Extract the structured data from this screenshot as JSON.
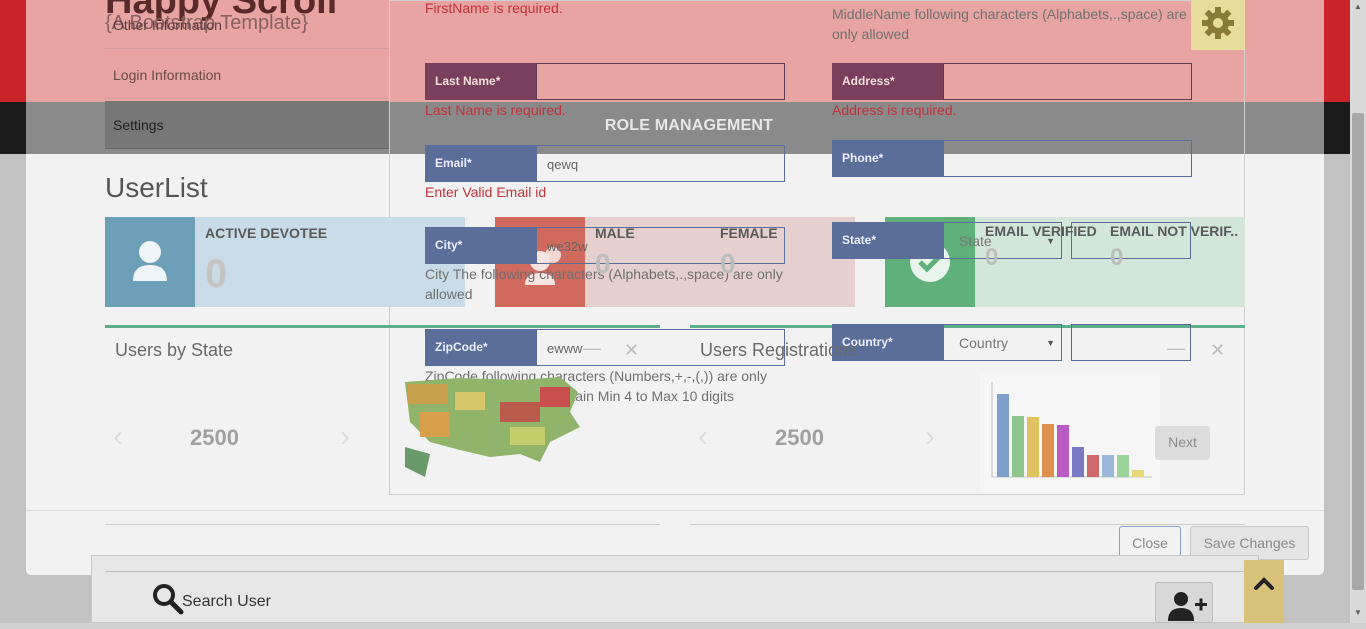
{
  "site": {
    "title": "Happy Scroll",
    "subtitle": "{A Bootstrap Template}"
  },
  "menu": {
    "items": [
      {
        "label": "Other Information"
      },
      {
        "label": "Login Information"
      },
      {
        "label": "Settings"
      }
    ]
  },
  "modal": {
    "heading": "ROLE MANAGEMENT",
    "fields": {
      "firstname_error": "FirstName is required.",
      "middlename_note": "MiddleName following characters (Alphabets,.,space) are only allowed",
      "lastname": {
        "label": "Last Name*",
        "value": "",
        "error": "Last Name is required."
      },
      "address": {
        "label": "Address*",
        "value": "",
        "error": "Address is required."
      },
      "email": {
        "label": "Email*",
        "value": "qewq",
        "error": "Enter Valid Email id"
      },
      "phone": {
        "label": "Phone*",
        "value": ""
      },
      "city": {
        "label": "City*",
        "value": "we32w",
        "note": "City The following characters (Alphabets,.,space) are only allowed"
      },
      "state": {
        "label": "State*",
        "selected": "State"
      },
      "zipcode": {
        "label": "ZipCode*",
        "value": "ewww",
        "note": "ZipCode following characters (Numbers,+,-,(,)) are only allowed and should contain Min 4 to Max 10 digits"
      },
      "country": {
        "label": "Country*",
        "selected": "Country"
      }
    },
    "buttons": {
      "next": "Next",
      "close": "Close",
      "save": "Save Changes"
    }
  },
  "userlist": {
    "heading": "UserList",
    "cards": {
      "active": {
        "label": "ACTIVE DEVOTEE",
        "value": "0"
      },
      "male": {
        "label": "MALE",
        "value": "0"
      },
      "female": {
        "label": "FEMALE",
        "value": "0"
      },
      "email_verified": {
        "label": "EMAIL VERIFIED",
        "value": "0"
      },
      "email_not_verified": {
        "label": "EMAIL NOT VERIF..",
        "value": "0"
      }
    },
    "panels": {
      "by_state": {
        "title": "Users by State",
        "value": "2500"
      },
      "registrations": {
        "title": "Users Registrations",
        "value": "2500"
      }
    }
  },
  "bottom": {
    "search_label": "Search User"
  },
  "colors": {
    "header_red": "#c9242a",
    "card_blue": "#6e9fb8",
    "card_red": "#d06a5e",
    "card_green": "#5fb07b",
    "gear_yellow": "#e8dc9c"
  },
  "icons": [
    "gear-icon",
    "user-icon",
    "users-icon",
    "check-circle-icon",
    "search-icon",
    "add-user-icon",
    "chevron-up-icon",
    "chevron-left-icon",
    "chevron-right-icon",
    "close-icon",
    "minus-icon"
  ]
}
